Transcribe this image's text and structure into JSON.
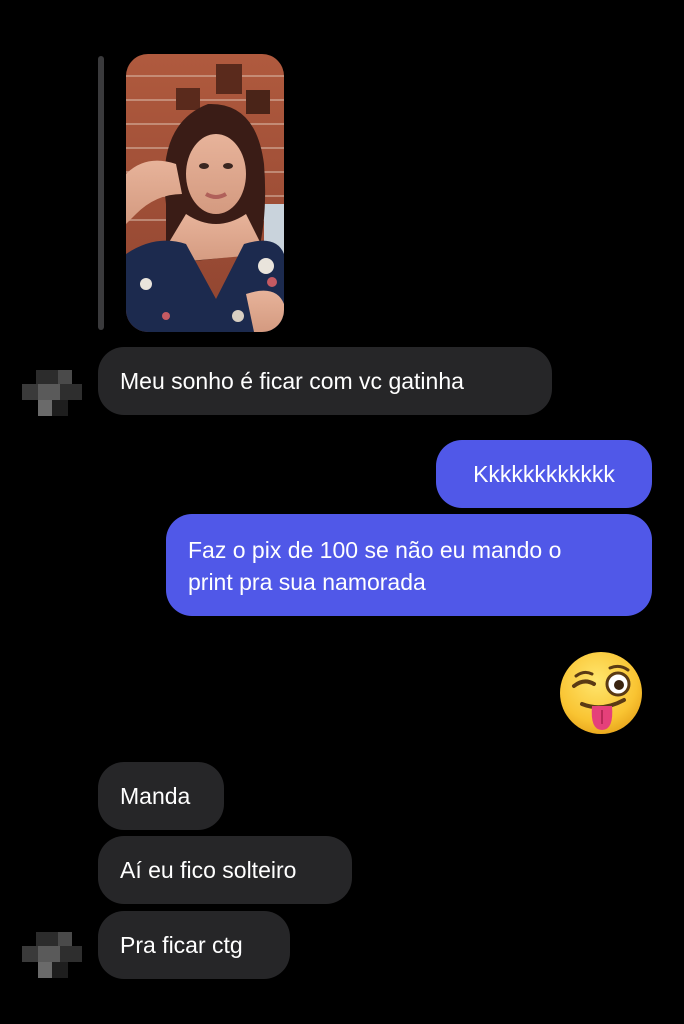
{
  "conversation": {
    "shared_photo": {
      "description_icon": "photo-thumbnail"
    },
    "messages": [
      {
        "sender": "them",
        "text": "Meu sonho é ficar com vc gatinha"
      },
      {
        "sender": "me",
        "text": "Kkkkkkkkkkkk"
      },
      {
        "sender": "me",
        "text_line1": "Faz o pix de 100 se não eu mando o",
        "text_line2": "print pra sua namorada"
      },
      {
        "sender": "me",
        "emoji": "winking-face-with-tongue"
      },
      {
        "sender": "them",
        "text": "Manda"
      },
      {
        "sender": "them",
        "text": "Aí eu fico solteiro"
      },
      {
        "sender": "them",
        "text": "Pra ficar ctg"
      }
    ]
  },
  "colors": {
    "background": "#000000",
    "incoming_bubble": "#262628",
    "outgoing_bubble": "#5058e8",
    "text": "#ffffff"
  }
}
